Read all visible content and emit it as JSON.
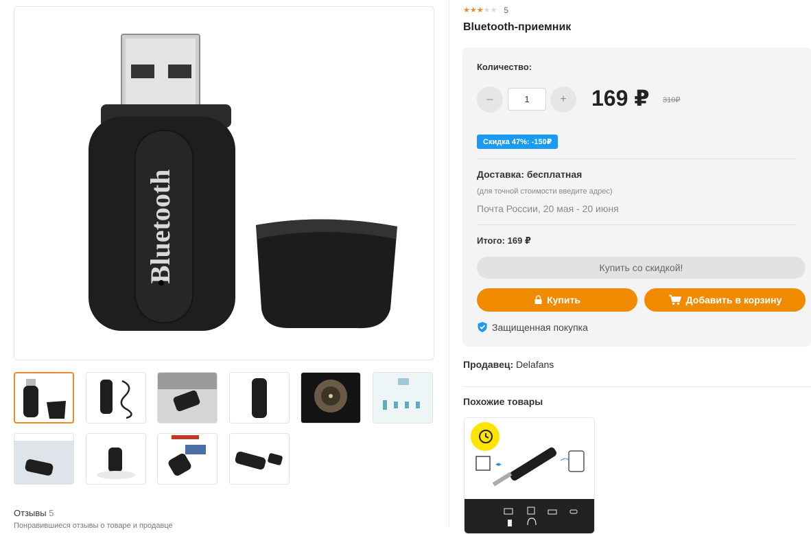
{
  "product": {
    "rating": 3,
    "rating_max": 5,
    "reviews_count": "5",
    "title": "Bluetooth-приемник",
    "device_label": "Bluetooth"
  },
  "buy_box": {
    "quantity_label": "Количество:",
    "minus": "–",
    "plus": "+",
    "quantity_value": "1",
    "price": "169 ₽",
    "old_price": "310₽",
    "discount_badge": "Скидка 47%: -150₽",
    "delivery": "Доставка: бесплатная",
    "delivery_note": "(для точной стоимости введите адрес)",
    "delivery_dates": "Почта России, 20 мая - 20 июня",
    "total": "Итого: 169 ₽",
    "discount_button": "Купить со скидкой!",
    "buy_button": "Купить",
    "cart_button": "Добавить в корзину",
    "secure": "Защищенная покупка"
  },
  "seller": {
    "label": "Продавец:",
    "name": "Delafans"
  },
  "similar": {
    "title": "Похожие товары"
  },
  "reviews": {
    "title": "Отзывы",
    "count": "5",
    "subtitle": "Понравившиеся отзывы о товаре и продавце"
  },
  "thumbnails": [
    "receiver-with-cap",
    "receiver-with-cable",
    "receiver-in-laptop",
    "receiver-closeup",
    "vinyl-record",
    "usage-diagram",
    "car-usage",
    "receiver-white-bg",
    "receiver-with-box",
    "receiver-side-view"
  ],
  "colors": {
    "accent_orange": "#f08a00",
    "discount_blue": "#1a9af0",
    "star": "#f0882a"
  }
}
